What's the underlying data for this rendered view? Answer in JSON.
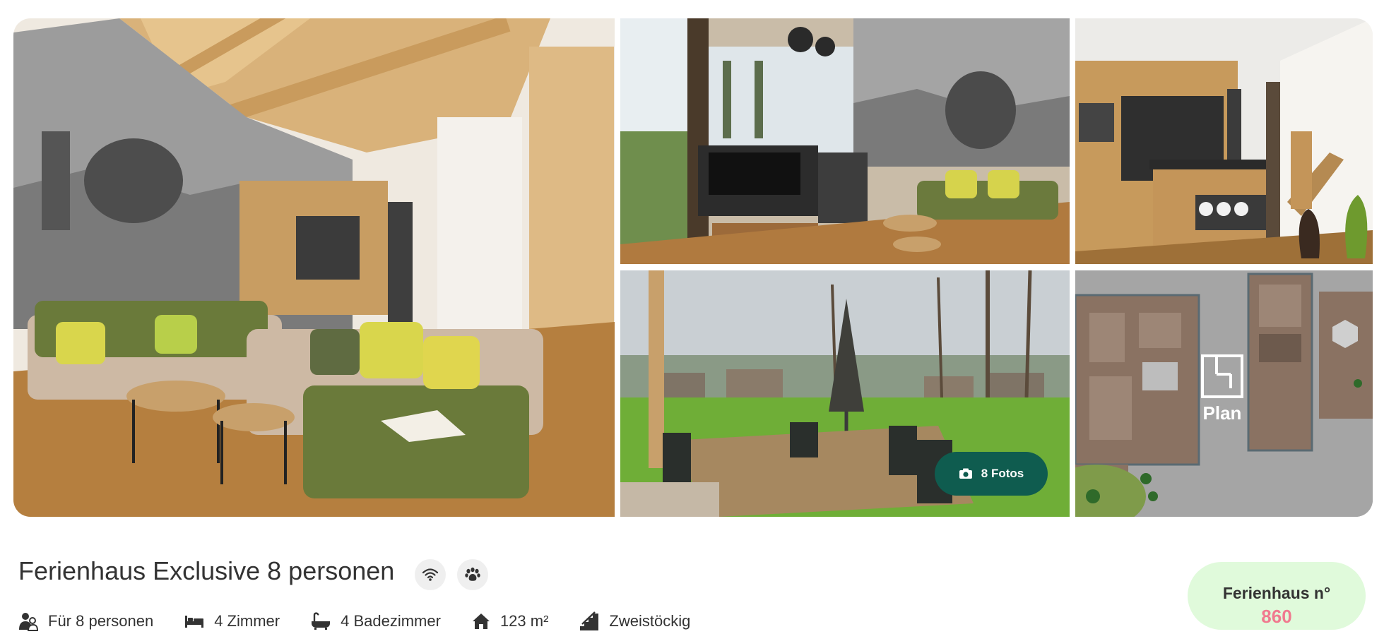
{
  "gallery": {
    "photos_button": {
      "label": "8 Fotos",
      "icon": "camera-icon"
    },
    "plan_label": "Plan"
  },
  "listing": {
    "title": "Ferienhaus Exclusive 8 personen",
    "amenities": [
      {
        "icon": "wifi-icon"
      },
      {
        "icon": "pet-paw-icon"
      }
    ],
    "features": [
      {
        "icon": "persons-icon",
        "label": "Für 8 personen"
      },
      {
        "icon": "bed-icon",
        "label": "4 Zimmer"
      },
      {
        "icon": "bathtub-icon",
        "label": "4 Badezimmer"
      },
      {
        "icon": "house-icon",
        "label": "123 m²"
      },
      {
        "icon": "stairs-icon",
        "label": "Zweistöckig"
      }
    ]
  },
  "badge": {
    "label": "Ferienhaus n°",
    "number": "860"
  },
  "colors": {
    "accent": "#0f5c4f",
    "badge_bg": "#e0fadb",
    "badge_number": "#f07a8f"
  }
}
